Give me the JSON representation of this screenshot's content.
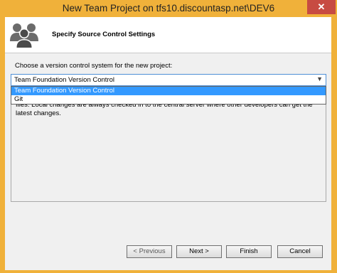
{
  "window": {
    "title": "New Team Project on tfs10.discountasp.net\\DEV6",
    "close_glyph": "✕"
  },
  "header": {
    "title": "Specify Source Control Settings",
    "icon": "users-icon"
  },
  "main": {
    "choose_label": "Choose a version control system for the new project:",
    "selected_value": "Team Foundation Version Control",
    "options": [
      "Team Foundation Version Control",
      "Git"
    ],
    "description": "files.  Local changes are always checked in to the central server where other developers can get the latest changes."
  },
  "footer": {
    "previous_label": "< Previous",
    "next_label": "Next >",
    "finish_label": "Finish",
    "cancel_label": "Cancel"
  },
  "colors": {
    "title_bar": "#f0b13a",
    "close_button": "#c74b42",
    "selection": "#3399ff",
    "focus_border": "#4f8fd6"
  }
}
